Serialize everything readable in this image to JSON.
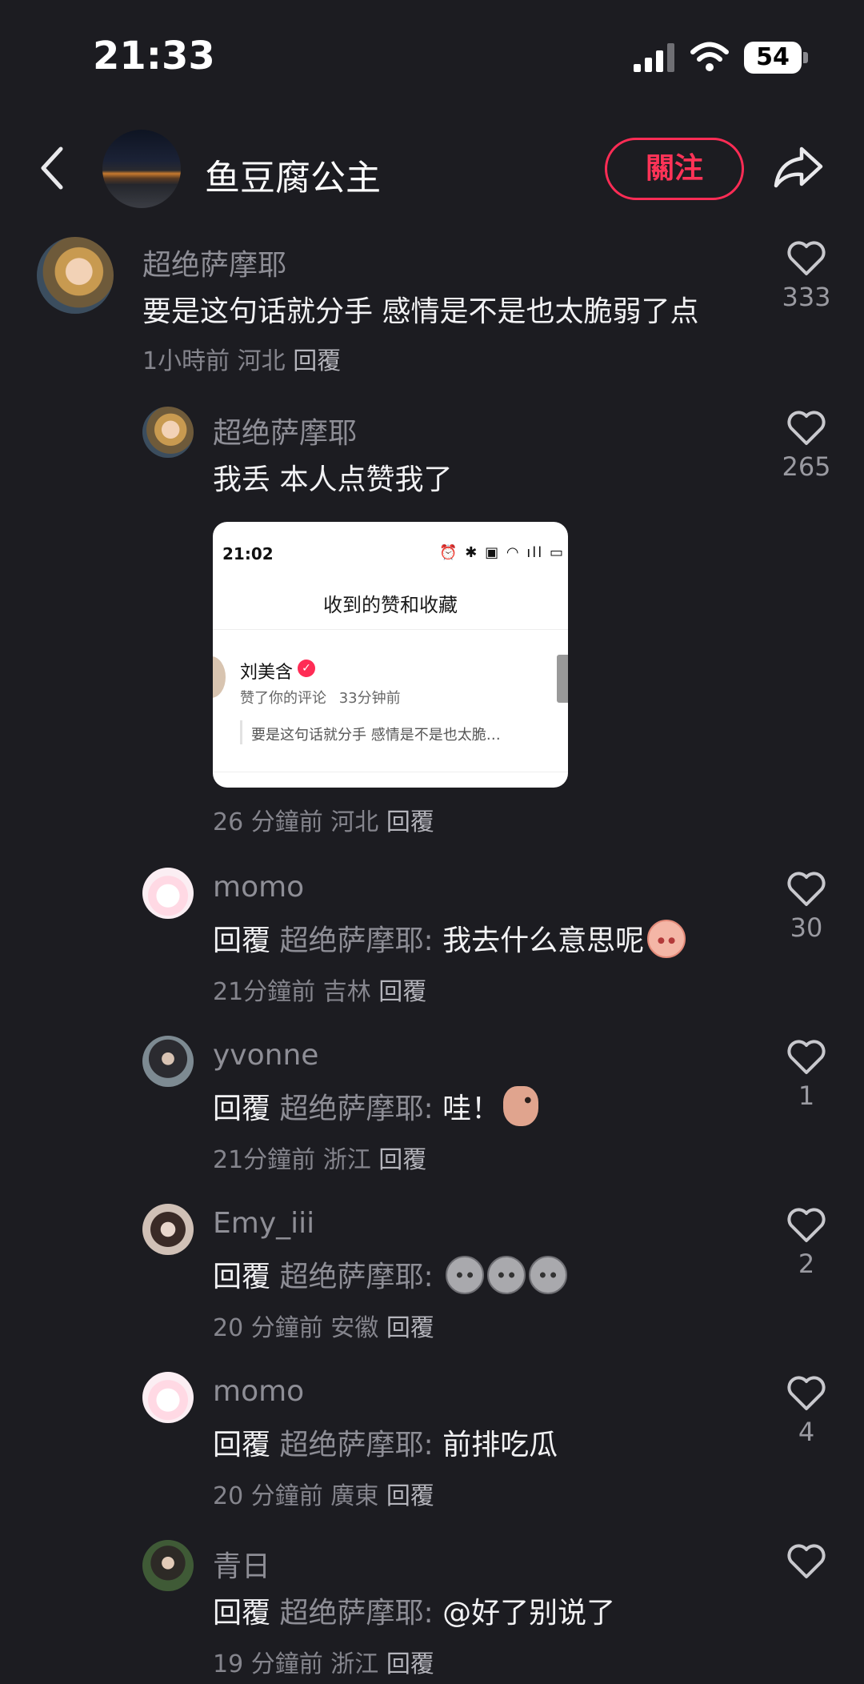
{
  "status_bar": {
    "time": "21:33",
    "battery": "54"
  },
  "header": {
    "name": "鱼豆腐公主",
    "follow_label": "關注"
  },
  "main_comment": {
    "username": "超绝萨摩耶",
    "text": "要是这句话就分手 感情是不是也太脆弱了点",
    "time": "1小時前",
    "location": "河北",
    "reply_label": "回覆",
    "likes": "333"
  },
  "replies": [
    {
      "username": "超绝萨摩耶",
      "text": "我丢 本人点赞我了",
      "time": "26 分鐘前",
      "location": "河北",
      "reply_label": "回覆",
      "likes": "265",
      "screenshot": {
        "time": "21:02",
        "title": "收到的赞和收藏",
        "name": "刘美含",
        "action": "赞了你的评论",
        "ago": "33分钟前",
        "quote": "要是这句话就分手 感情是不是也太脆…"
      }
    },
    {
      "username": "momo",
      "reply_prefix": "回覆",
      "reply_target": "超绝萨摩耶:",
      "text": "我去什么意思呢",
      "emoji": "peach-face-emoji",
      "time": "21分鐘前",
      "location": "吉林",
      "reply_label": "回覆",
      "likes": "30"
    },
    {
      "username": "yvonne",
      "reply_prefix": "回覆",
      "reply_target": "超绝萨摩耶:",
      "text": "哇！",
      "emoji": "peeking-bean-emoji",
      "time": "21分鐘前",
      "location": "浙江",
      "reply_label": "回覆",
      "likes": "1"
    },
    {
      "username": "Emy_iii",
      "reply_prefix": "回覆",
      "reply_target": "超绝萨摩耶:",
      "text": "",
      "emoji": "stone-face-emoji",
      "time": "20 分鐘前",
      "location": "安徽",
      "reply_label": "回覆",
      "likes": "2"
    },
    {
      "username": "momo",
      "reply_prefix": "回覆",
      "reply_target": "超绝萨摩耶:",
      "text": "前排吃瓜",
      "time": "20 分鐘前",
      "location": "廣東",
      "reply_label": "回覆",
      "likes": "4"
    },
    {
      "username": "青日",
      "reply_prefix": "回覆",
      "reply_target": "超绝萨摩耶:",
      "text": "@好了别说了",
      "time": "19 分鐘前",
      "location": "浙江",
      "reply_label": "回覆",
      "likes": ""
    }
  ]
}
